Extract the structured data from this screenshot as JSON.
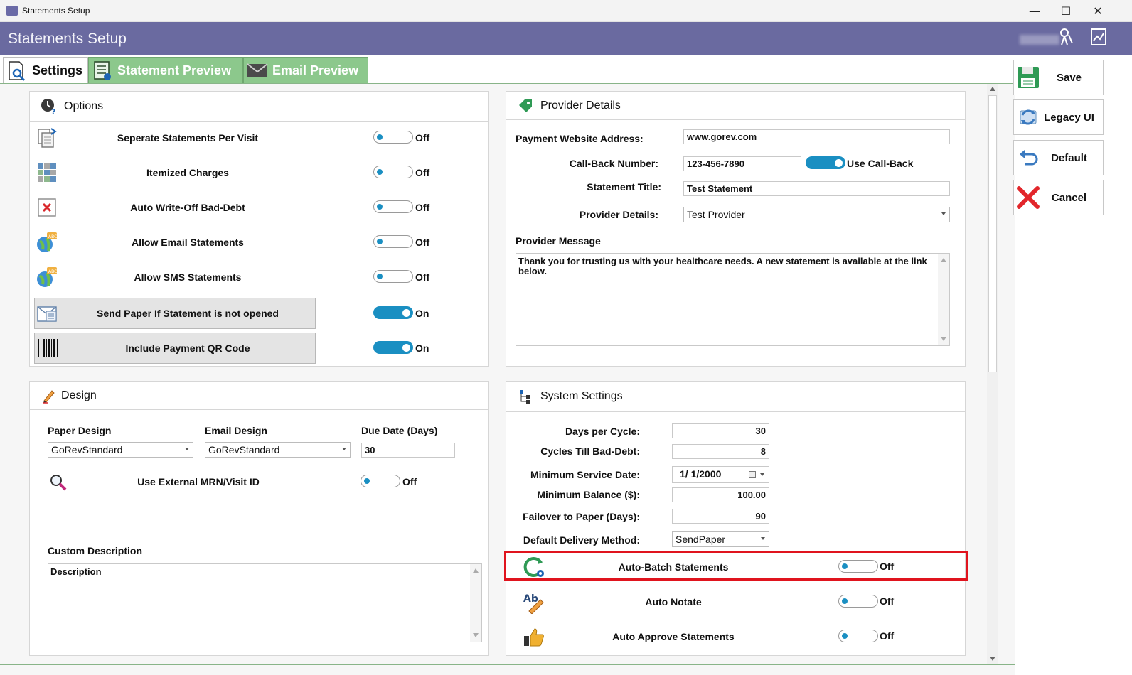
{
  "window": {
    "title": "Statements Setup",
    "minimize": "—",
    "maximize": "☐",
    "close": "✕"
  },
  "header": {
    "title": "Statements Setup",
    "user_icon": "user-keys-icon",
    "report_icon": "report-chart-icon"
  },
  "tabs": [
    {
      "label": "Settings",
      "icon": "document-search-icon",
      "active": true
    },
    {
      "label": "Statement Preview",
      "icon": "document-list-icon",
      "active": false
    },
    {
      "label": "Email Preview",
      "icon": "envelope-icon",
      "active": false
    }
  ],
  "options": {
    "title": "Options",
    "rows": [
      {
        "label": "Seperate Statements Per Visit",
        "state": "Off",
        "on": false,
        "icon": "documents-stack-icon"
      },
      {
        "label": "Itemized Charges",
        "state": "Off",
        "on": false,
        "icon": "grid-tiles-icon"
      },
      {
        "label": "Auto Write-Off Bad-Debt",
        "state": "Off",
        "on": false,
        "icon": "document-x-icon"
      },
      {
        "label": "Allow Email Statements",
        "state": "Off",
        "on": false,
        "icon": "globe-abc-icon"
      },
      {
        "label": "Allow SMS Statements",
        "state": "Off",
        "on": false,
        "icon": "globe-abc-icon"
      },
      {
        "label": "Send Paper If Statement is not opened",
        "state": "On",
        "on": true,
        "icon": "mail-paper-icon"
      },
      {
        "label": "Include Payment QR Code",
        "state": "On",
        "on": true,
        "icon": "barcode-icon"
      }
    ]
  },
  "provider": {
    "title": "Provider Details",
    "website_label": "Payment Website Address:",
    "website_value": "www.gorev.com",
    "callback_label": "Call-Back Number:",
    "callback_value": "123-456-7890",
    "use_callback_label": "Use Call-Back",
    "use_callback_on": true,
    "statement_title_label": "Statement Title:",
    "statement_title_value": "Test Statement",
    "provider_details_label": "Provider Details:",
    "provider_details_value": "Test Provider",
    "message_label": "Provider Message",
    "message_value": "Thank you for trusting us with your healthcare needs.  A new statement is available at the link below."
  },
  "design": {
    "title": "Design",
    "paper_label": "Paper Design",
    "paper_value": "GoRevStandard",
    "email_label": "Email Design",
    "email_value": "GoRevStandard",
    "due_label": "Due Date (Days)",
    "due_value": "30",
    "external_label": "Use External MRN/Visit ID",
    "external_state": "Off",
    "custom_label": "Custom Description",
    "custom_value": "Description"
  },
  "system": {
    "title": "System Settings",
    "days_label": "Days per Cycle:",
    "days_value": "30",
    "cycles_label": "Cycles Till Bad-Debt:",
    "cycles_value": "8",
    "min_date_label": "Minimum Service Date:",
    "min_date_value": "1/  1/2000",
    "min_balance_label": "Minimum Balance ($):",
    "min_balance_value": "100.00",
    "failover_label": "Failover to Paper (Days):",
    "failover_value": "90",
    "delivery_label": "Default Delivery Method:",
    "delivery_value": "SendPaper",
    "autobatch_label": "Auto-Batch Statements",
    "autobatch_state": "Off",
    "autonotate_label": "Auto Notate",
    "autonotate_state": "Off",
    "autoapprove_label": "Auto Approve Statements",
    "autoapprove_state": "Off"
  },
  "actions": {
    "save": "Save",
    "legacy": "Legacy UI",
    "default": "Default",
    "cancel": "Cancel"
  },
  "colors": {
    "header": "#6a6aa0",
    "tab_inactive": "#8cc88c",
    "toggle_on": "#1a8fc2",
    "highlight": "#e0141e"
  }
}
